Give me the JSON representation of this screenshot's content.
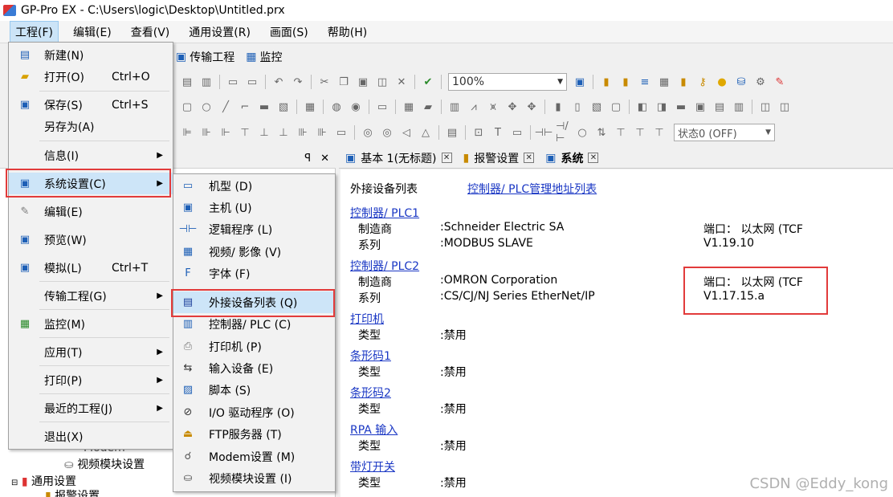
{
  "window": {
    "title": "GP-Pro EX - C:\\Users\\logic\\Desktop\\Untitled.prx"
  },
  "menubar": {
    "items": [
      "工程(F)",
      "编辑(E)",
      "查看(V)",
      "通用设置(R)",
      "画面(S)",
      "帮助(H)"
    ]
  },
  "transfer_bar": {
    "transfer": "传输工程",
    "monitor": "监控"
  },
  "toolbar": {
    "zoom": "100%",
    "state": "状态0 (OFF)"
  },
  "file_menu": {
    "items": [
      {
        "label": "新建(N)",
        "shortcut": "",
        "icon": "new-icon"
      },
      {
        "label": "打开(O)",
        "shortcut": "Ctrl+O",
        "icon": "open-folder-icon"
      },
      {
        "label": "保存(S)",
        "shortcut": "Ctrl+S",
        "icon": "save-icon"
      },
      {
        "label": "另存为(A)",
        "shortcut": ""
      },
      {
        "label": "信息(I)",
        "shortcut": ""
      },
      {
        "label": "系统设置(C)",
        "shortcut": "",
        "icon": "system-settings-icon"
      },
      {
        "label": "编辑(E)",
        "shortcut": "",
        "icon": "edit-icon"
      },
      {
        "label": "预览(W)",
        "shortcut": "",
        "icon": "preview-icon"
      },
      {
        "label": "模拟(L)",
        "shortcut": "Ctrl+T",
        "icon": "simulate-icon"
      },
      {
        "label": "传输工程(G)",
        "shortcut": ""
      },
      {
        "label": "监控(M)",
        "shortcut": "",
        "icon": "monitor-icon"
      },
      {
        "label": "应用(T)",
        "shortcut": ""
      },
      {
        "label": "打印(P)",
        "shortcut": ""
      },
      {
        "label": "最近的工程(J)",
        "shortcut": ""
      },
      {
        "label": "退出(X)",
        "shortcut": ""
      }
    ]
  },
  "system_submenu": {
    "items": [
      {
        "label": "机型 (D)",
        "icon": "model-icon"
      },
      {
        "label": "主机 (U)",
        "icon": "host-icon"
      },
      {
        "label": "逻辑程序 (L)",
        "icon": "logic-program-icon"
      },
      {
        "label": "视频/ 影像 (V)",
        "icon": "video-icon"
      },
      {
        "label": "字体 (F)",
        "icon": "font-icon"
      },
      {
        "label": "外接设备列表 (Q)",
        "icon": "device-list-icon"
      },
      {
        "label": "控制器/ PLC (C)",
        "icon": "plc-icon"
      },
      {
        "label": "打印机 (P)",
        "icon": "printer-icon"
      },
      {
        "label": "输入设备 (E)",
        "icon": "input-device-icon"
      },
      {
        "label": "脚本 (S)",
        "icon": "script-icon"
      },
      {
        "label": "I/O 驱动程序 (O)",
        "icon": "io-driver-icon"
      },
      {
        "label": "FTP服务器 (T)",
        "icon": "ftp-server-icon"
      },
      {
        "label": "Modem设置 (M)",
        "icon": "modem-icon"
      },
      {
        "label": "视频模块设置 (I)",
        "icon": "video-module-icon"
      }
    ]
  },
  "tree": {
    "items": [
      "Modem",
      "视频模块设置",
      "通用设置",
      "报警设置"
    ]
  },
  "doc_tabs": [
    {
      "label": "基本 1(无标题)"
    },
    {
      "label": "报警设置"
    },
    {
      "label": "系统"
    }
  ],
  "content": {
    "heading": "外接设备列表",
    "heading_link": "控制器/ PLC管理地址列表",
    "plc1": {
      "link": "控制器/ PLC1",
      "maker_label": "制造商",
      "maker_value": ":Schneider Electric SA",
      "series_label": "系列",
      "series_value": ":MODBUS SLAVE",
      "port": "端口： 以太网 (TCF",
      "version": "V1.19.10"
    },
    "plc2": {
      "link": "控制器/ PLC2",
      "maker_label": "制造商",
      "maker_value": ":OMRON Corporation",
      "series_label": "系列",
      "series_value": ":CS/CJ/NJ Series EtherNet/IP",
      "port": "端口： 以太网 (TCF",
      "version": "V1.17.15.a"
    },
    "devices": [
      {
        "link": "打印机",
        "type_label": "类型",
        "type_value": ":禁用"
      },
      {
        "link": "条形码1",
        "type_label": "类型",
        "type_value": ":禁用"
      },
      {
        "link": "条形码2",
        "type_label": "类型",
        "type_value": ":禁用"
      },
      {
        "link": "RPA 输入",
        "type_label": "类型",
        "type_value": ":禁用"
      },
      {
        "link": "带灯开关",
        "type_label": "类型",
        "type_value": ":禁用"
      }
    ]
  },
  "watermark": "CSDN @Eddy_kong",
  "colors": {
    "highlight": "#cde5f8",
    "annotation": "#e23b3b",
    "link": "#1a37c4"
  }
}
